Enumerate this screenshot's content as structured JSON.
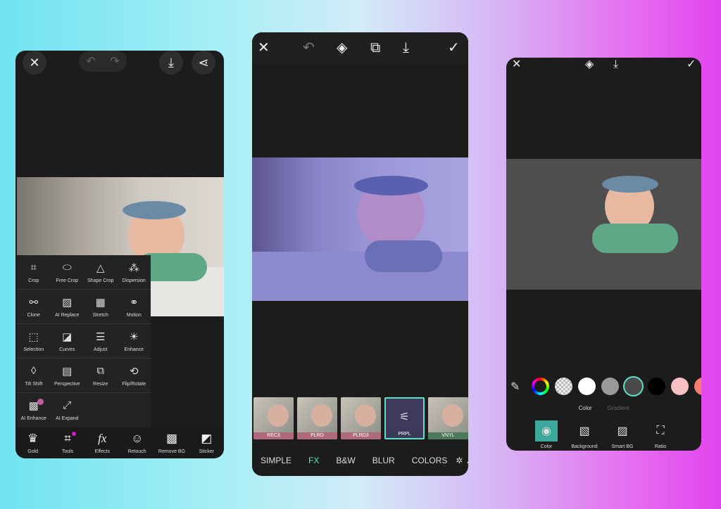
{
  "left_editor": {
    "top_icons": [
      "close-icon",
      "undo-icon",
      "redo-icon",
      "download-icon",
      "share-icon"
    ],
    "tools": [
      "Crop",
      "Free Crop",
      "Shape Crop",
      "Dispersion",
      "Clone",
      "AI Replace",
      "Stretch",
      "Motion",
      "Selection",
      "Curves",
      "Adjust",
      "Enhance",
      "Tilt Shift",
      "Perspective",
      "Resize",
      "Flip/Rotate",
      "AI Enhance",
      "AI Expand"
    ],
    "bottom_bar": [
      "Gold",
      "Tools",
      "Effects",
      "Retouch",
      "Remove BG",
      "Sticker"
    ],
    "notification_color": "#d11acb"
  },
  "middle_editor": {
    "top_icons": [
      "close-icon",
      "undo-icon",
      "eraser-icon",
      "compare-icon",
      "download-icon",
      "check-icon"
    ],
    "filters": [
      {
        "label": "REC3",
        "color": "#b06a7e"
      },
      {
        "label": "PLRD",
        "color": "#b06a7e"
      },
      {
        "label": "PLRD3",
        "color": "#b06a7e"
      },
      {
        "label": "PRPL",
        "color": "#3a3a58",
        "selected": true
      },
      {
        "label": "VNYL",
        "color": "#4d7a5a"
      }
    ],
    "tabs": [
      "SIMPLE",
      "FX",
      "B&W",
      "BLUR",
      "COLORS",
      "A"
    ],
    "active_tab": "FX",
    "accent": "#5ee0c8"
  },
  "right_editor": {
    "top_icons": [
      "close-icon",
      "eraser-icon",
      "download-icon",
      "check-icon"
    ],
    "swatches": [
      "color-wheel",
      "transparent",
      "#ffffff",
      "#999999",
      "#4a4a4a",
      "#000000",
      "#f8c0c4",
      "#f58070"
    ],
    "selected_swatch": "#4a4a4a",
    "mode_tabs": {
      "color": "Color",
      "gradient": "Gradient"
    },
    "bottom_tools": [
      "Color",
      "Background",
      "Smart BG",
      "Ratio"
    ],
    "accent": "#3aa89a"
  }
}
